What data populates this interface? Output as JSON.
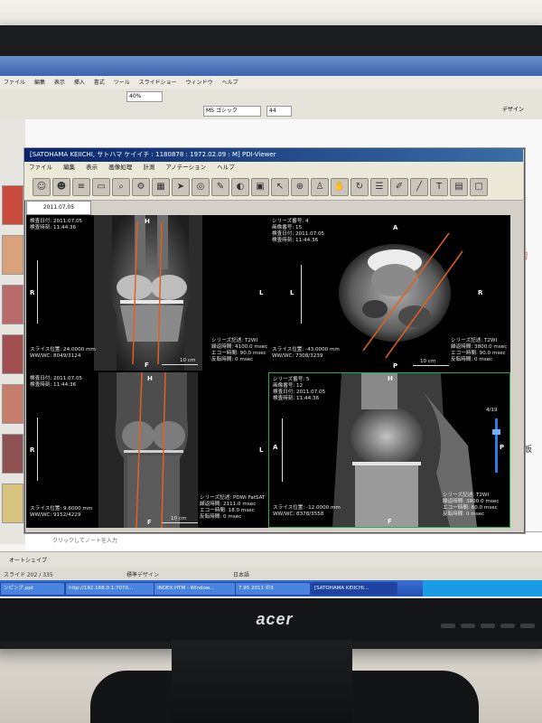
{
  "monitor": {
    "brand": "acer"
  },
  "background_app": {
    "menu": [
      "ファイル",
      "編集",
      "表示",
      "挿入",
      "書式",
      "ツール",
      "スライドショー",
      "ウィンドウ",
      "ヘルプ"
    ],
    "zoom": "40%",
    "font_name": "MS ゴシック",
    "font_size": "44",
    "design_label": "デザイン",
    "slide_side_text": "字靭",
    "slide_side_text2": "半月板",
    "notes_placeholder": "クリックしてノートを入力",
    "drawbar_label": "オートシェイプ",
    "status": {
      "slide": "スライド 202 / 335",
      "template": "標準デザイン",
      "language": "日本語"
    },
    "taskbar": [
      {
        "label": "ンピング.ppt",
        "active": false
      },
      {
        "label": "http://192.168.0.1:7070...",
        "active": false
      },
      {
        "label": "INDEX.HTM - Window...",
        "active": false
      },
      {
        "label": "7.95 2011 の3",
        "active": false
      },
      {
        "label": "[SATOHAMA KEIICHI...",
        "active": true
      }
    ]
  },
  "viewer": {
    "title": "[SATOHAMA KEIICHI, サトハマ ケイイチ : 1180878 : 1972.02.09 : M] PDI-Viewer",
    "menu": [
      "ファイル",
      "編集",
      "表示",
      "画像処理",
      "計測",
      "アノテーション",
      "ヘルプ"
    ],
    "date_tab": "2011.07.05",
    "toolbar_icons": [
      "patient-icon",
      "users-icon",
      "list-icon",
      "folder-icon",
      "find-icon",
      "tools-icon",
      "grid-icon",
      "pointer-icon",
      "target-icon",
      "edit-icon",
      "contrast-icon",
      "layout-icon",
      "cursor-icon",
      "zoom-icon",
      "person-icon",
      "hand-icon",
      "rotate-icon",
      "stack-icon",
      "pen-icon",
      "line-icon",
      "text-icon",
      "save-icon",
      "monitor-icon"
    ],
    "panes": [
      {
        "study_date": "検査日付: 2011.07.05",
        "study_time": "検査時刻: 11:44:36",
        "series": "",
        "slice": "スライス位置: 24.0000 mm",
        "wwwc": "WW/WC: 8049/3124",
        "sequence": "シリーズ記述: T2WI",
        "tr": "繰返時間: 4100.0 msec",
        "te": "エコー時間: 90.0 msec",
        "ti": "反転時間: 0 msec",
        "top": "H",
        "bottom": "F",
        "left": "R",
        "right": "L",
        "scale": "10 cm"
      },
      {
        "series": "シリーズ番号: 4",
        "image": "画像番号: 15",
        "study_date": "検査日付: 2011.07.05",
        "study_time": "検査時刻: 11:44:36",
        "slice": "スライス位置: -43.0000 mm",
        "wwwc": "WW/WC: 7308/3239",
        "sequence": "シリーズ記述: T2WI",
        "tr": "繰返時間: 3800.0 msec",
        "te": "エコー時間: 90.0 msec",
        "ti": "反転時間: 0 msec",
        "top": "A",
        "bottom": "P",
        "left": "L",
        "right": "R",
        "scale": "10 cm"
      },
      {
        "study_date": "検査日付: 2011.07.05",
        "study_time": "検査時刻: 11:44:36",
        "slice": "スライス位置: 9.6000 mm",
        "wwwc": "WW/WC: 9152/4229",
        "sequence": "シリーズ記述: PDWI FatSAT",
        "tr": "繰返時間: 2111.0 msec",
        "te": "エコー時間: 18.0 msec",
        "ti": "反転時間: 0 msec",
        "top": "H",
        "bottom": "F",
        "left": "R",
        "right": "L",
        "scale": "10 cm"
      },
      {
        "series": "シリーズ番号: 5",
        "image": "画像番号: 12",
        "study_date": "検査日付: 2011.07.05",
        "study_time": "検査時刻: 11:44:36",
        "slice": "スライス位置: -12.0000 mm",
        "wwwc": "WW/WC: 8378/3558",
        "sequence": "シリーズ記述: T2WI",
        "tr": "繰返時間: 3800.0 msec",
        "te": "エコー時間: 60.0 msec",
        "ti": "反転時間: 0 msec",
        "top": "H",
        "bottom": "F",
        "left": "A",
        "right": "P",
        "scale": "10 cm",
        "frame": "4/19"
      }
    ]
  }
}
